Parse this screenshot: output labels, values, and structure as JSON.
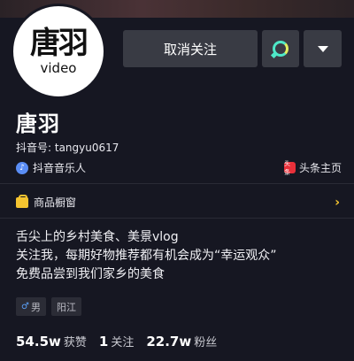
{
  "profile": {
    "avatar": {
      "logo_mark": "唐羽",
      "logo_sub": "video"
    },
    "name": "唐羽",
    "douyin_id": "抖音号: tangyu0617",
    "music_label": "抖音音乐人",
    "toutiao_label": "头条主页",
    "toutiao_badge": "头条"
  },
  "actions": {
    "unfollow_label": "取消关注",
    "chat_icon": "chat-bubble-icon",
    "more_icon": "caret-down-icon"
  },
  "shop": {
    "label": "商品橱窗",
    "chevron": "›"
  },
  "bio": [
    "舌尖上的乡村美食、美景vlog",
    "关注我，每期好物推荐都有机会成为“幸运观众”",
    "免费品尝到我们家乡的美食"
  ],
  "chips": {
    "gender_symbol": "♂",
    "gender": "男",
    "location": "阳江"
  },
  "stats": [
    {
      "num": "54.5w",
      "label": "获赞"
    },
    {
      "num": "1",
      "label": "关注"
    },
    {
      "num": "22.7w",
      "label": "粉丝"
    }
  ],
  "colors": {
    "background": "#161722",
    "accent_yellow": "#f5c430",
    "chat_teal": "#4ee8c8"
  }
}
